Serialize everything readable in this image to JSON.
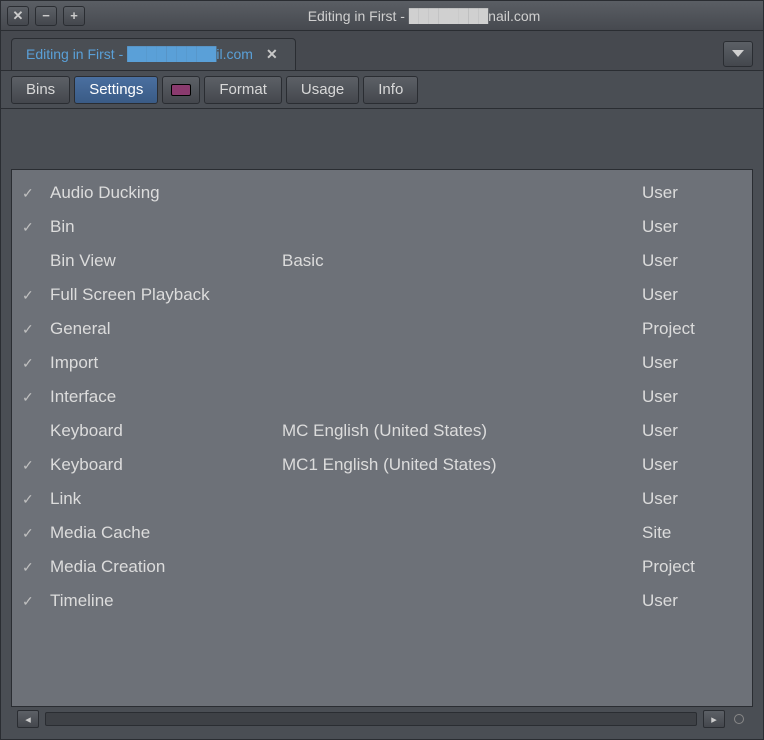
{
  "window": {
    "title": "Editing in First - ████████nail.com"
  },
  "tab": {
    "label": "Editing in First - █████████il.com"
  },
  "toolbar": {
    "bins": "Bins",
    "settings": "Settings",
    "format": "Format",
    "usage": "Usage",
    "info": "Info"
  },
  "settings": {
    "rows": [
      {
        "checked": true,
        "name": "Audio Ducking",
        "value": "",
        "scope": "User"
      },
      {
        "checked": true,
        "name": "Bin",
        "value": "",
        "scope": "User"
      },
      {
        "checked": false,
        "name": "Bin View",
        "value": "Basic",
        "scope": "User"
      },
      {
        "checked": true,
        "name": "Full Screen Playback",
        "value": "",
        "scope": "User"
      },
      {
        "checked": true,
        "name": "General",
        "value": "",
        "scope": "Project"
      },
      {
        "checked": true,
        "name": "Import",
        "value": "",
        "scope": "User"
      },
      {
        "checked": true,
        "name": "Interface",
        "value": "",
        "scope": "User"
      },
      {
        "checked": false,
        "name": "Keyboard",
        "value": "MC English (United States)",
        "scope": "User"
      },
      {
        "checked": true,
        "name": "Keyboard",
        "value": "MC1 English (United States)",
        "scope": "User"
      },
      {
        "checked": true,
        "name": "Link",
        "value": "",
        "scope": "User"
      },
      {
        "checked": true,
        "name": "Media Cache",
        "value": "",
        "scope": "Site"
      },
      {
        "checked": true,
        "name": "Media Creation",
        "value": "",
        "scope": "Project"
      },
      {
        "checked": true,
        "name": "Timeline",
        "value": "",
        "scope": "User"
      }
    ]
  }
}
